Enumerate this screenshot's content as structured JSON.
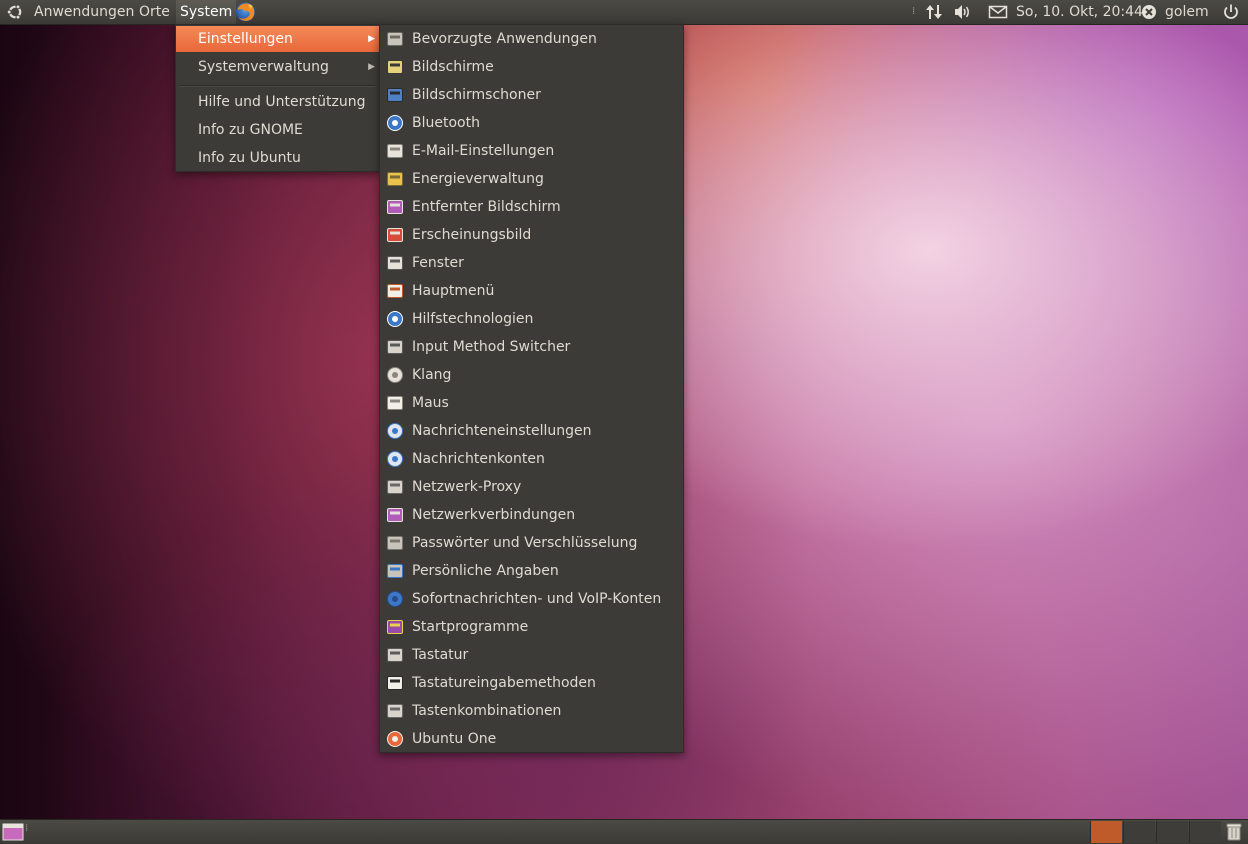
{
  "top_panel": {
    "menus": [
      "Anwendungen",
      "Orte",
      "System"
    ],
    "clock": "So, 10. Okt, 20:44",
    "user": "golem",
    "icons": [
      "ubuntu-logo-icon",
      "firefox-icon",
      "network-icon",
      "volume-icon",
      "mail-icon",
      "user-status-icon",
      "power-icon"
    ]
  },
  "system_menu": {
    "items": [
      {
        "label": "Einstellungen",
        "submenu": true,
        "active": true
      },
      {
        "label": "Systemverwaltung",
        "submenu": true
      },
      {
        "label": "Hilfe und Unterstützung"
      },
      {
        "label": "Info zu GNOME"
      },
      {
        "label": "Info zu Ubuntu"
      }
    ]
  },
  "einstellungen_menu": {
    "items": [
      {
        "label": "Bevorzugte Anwendungen",
        "icon": "preferred-apps-icon"
      },
      {
        "label": "Bildschirme",
        "icon": "display-icon"
      },
      {
        "label": "Bildschirmschoner",
        "icon": "screensaver-icon"
      },
      {
        "label": "Bluetooth",
        "icon": "bluetooth-icon"
      },
      {
        "label": "E-Mail-Einstellungen",
        "icon": "mail-settings-icon"
      },
      {
        "label": "Energieverwaltung",
        "icon": "power-management-icon"
      },
      {
        "label": "Entfernter Bildschirm",
        "icon": "remote-desktop-icon"
      },
      {
        "label": "Erscheinungsbild",
        "icon": "appearance-icon"
      },
      {
        "label": "Fenster",
        "icon": "windows-icon"
      },
      {
        "label": "Hauptmenü",
        "icon": "main-menu-icon"
      },
      {
        "label": "Hilfstechnologien",
        "icon": "accessibility-icon"
      },
      {
        "label": "Input Method Switcher",
        "icon": "keyboard-icon"
      },
      {
        "label": "Klang",
        "icon": "sound-icon"
      },
      {
        "label": "Maus",
        "icon": "mouse-icon"
      },
      {
        "label": "Nachrichteneinstellungen",
        "icon": "messaging-icon"
      },
      {
        "label": "Nachrichtenkonten",
        "icon": "messaging-accounts-icon"
      },
      {
        "label": "Netzwerk-Proxy",
        "icon": "network-proxy-icon"
      },
      {
        "label": "Netzwerkverbindungen",
        "icon": "network-connections-icon"
      },
      {
        "label": "Passwörter und Verschlüsselung",
        "icon": "keys-icon"
      },
      {
        "label": "Persönliche Angaben",
        "icon": "personal-info-icon"
      },
      {
        "label": "Sofortnachrichten- und VoIP-Konten",
        "icon": "im-accounts-icon"
      },
      {
        "label": "Startprogramme",
        "icon": "startup-apps-icon"
      },
      {
        "label": "Tastatur",
        "icon": "keyboard-icon"
      },
      {
        "label": "Tastatureingabemethoden",
        "icon": "input-methods-icon"
      },
      {
        "label": "Tastenkombinationen",
        "icon": "shortcuts-icon"
      },
      {
        "label": "Ubuntu One",
        "icon": "ubuntu-one-icon"
      }
    ]
  },
  "bottom_panel": {
    "workspaces": 4,
    "active_workspace": 1,
    "icons": [
      "show-desktop-icon",
      "trash-icon"
    ]
  },
  "colors": {
    "panel": "#3c3b37",
    "menu_bg": "#3c3b37",
    "highlight": "#f07746",
    "text": "#dfdbd2"
  }
}
